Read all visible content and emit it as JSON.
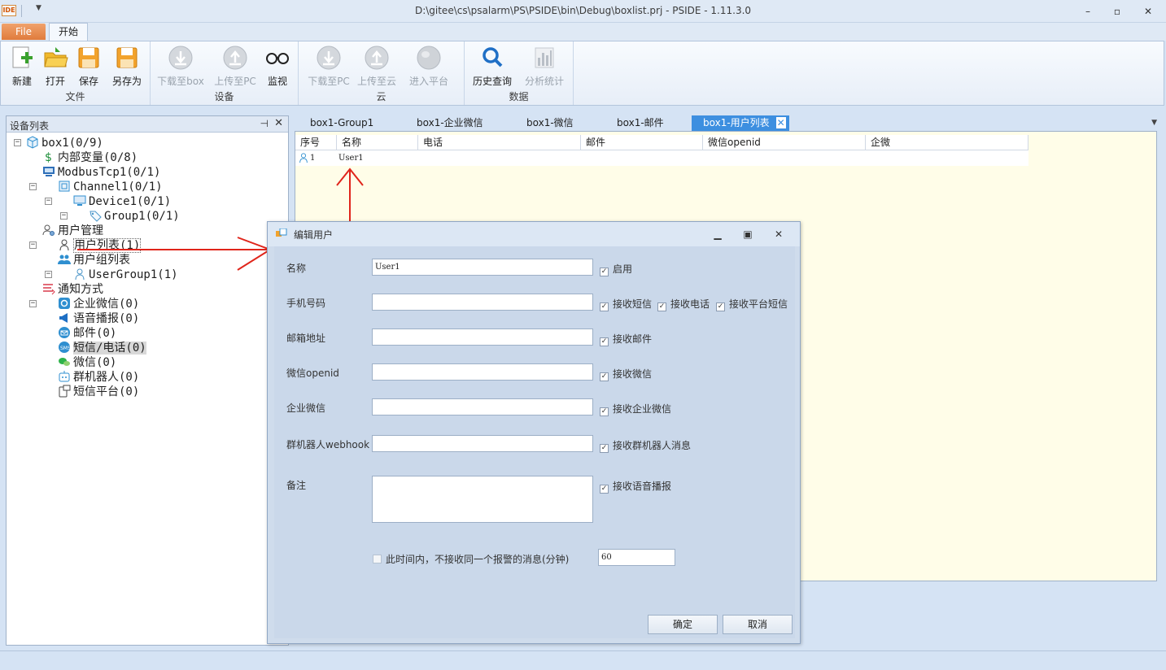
{
  "window": {
    "title": "D:\\gitee\\cs\\psalarm\\PS\\PSIDE\\bin\\Debug\\boxlist.prj - PSIDE - 1.11.3.0",
    "app_icon_text": "IDE",
    "minimize": "–",
    "restore": "▫",
    "close": "✕",
    "quick_access_drop": "▼"
  },
  "ribbon": {
    "file_tab": "File",
    "start_tab": "开始",
    "groups": {
      "file": {
        "label": "文件",
        "new": "新建",
        "open": "打开",
        "save": "保存",
        "save_as": "另存为"
      },
      "device": {
        "label": "设备",
        "download_box": "下载至box",
        "upload_pc": "上传至PC",
        "monitor": "监视"
      },
      "cloud": {
        "label": "云",
        "download_pc": "下载至PC",
        "upload_cloud": "上传至云",
        "enter_platform": "进入平台"
      },
      "data": {
        "label": "数据",
        "history": "历史查询",
        "analysis": "分析统计"
      }
    }
  },
  "left_panel": {
    "title": "设备列表",
    "pin": "📌",
    "close": "✕",
    "tree": [
      "box1(0/9)",
      "内部变量(0/8)",
      "ModbusTcp1(0/1)",
      "Channel1(0/1)",
      "Device1(0/1)",
      "Group1(0/1)",
      "用户管理",
      "用户列表(1)",
      "用户组列表",
      "UserGroup1(1)",
      "通知方式",
      "企业微信(0)",
      "语音播报(0)",
      "邮件(0)",
      "短信/电话(0)",
      "微信(0)",
      "群机器人(0)",
      "短信平台(0)"
    ]
  },
  "doc_tabs": [
    "box1-Group1",
    "box1-企业微信",
    "box1-微信",
    "box1-邮件",
    "box1-用户列表"
  ],
  "doc_tab_close": "✕",
  "tab_menu": "▼",
  "grid": {
    "headers": [
      "序号",
      "名称",
      "电话",
      "邮件",
      "微信openid",
      "企微"
    ],
    "row": {
      "index": "1",
      "name": "User1"
    }
  },
  "dialog": {
    "title": "编辑用户",
    "minimize": "▁",
    "restore": "▣",
    "close": "✕",
    "fields": {
      "name_label": "名称",
      "name_value": "User1",
      "phone_label": "手机号码",
      "email_label": "邮箱地址",
      "wechat_label": "微信openid",
      "wework_label": "企业微信",
      "robot_label": "群机器人webhook",
      "note_label": "备注"
    },
    "checkboxes": {
      "enabled": "启用",
      "recv_sms": "接收短信",
      "recv_call": "接收电话",
      "recv_platform_sms": "接收平台短信",
      "recv_email": "接收邮件",
      "recv_wechat": "接收微信",
      "recv_wework": "接收企业微信",
      "recv_robot": "接收群机器人消息",
      "recv_voice": "接收语音播报",
      "mute_repeat": "此时间内，不接收同一个报警的消息(分钟)"
    },
    "check_mark": "✓",
    "mute_minutes": "60",
    "ok": "确定",
    "cancel": "取消"
  },
  "colors": {
    "accent_tab": "#3d8fe0",
    "file_tab": "#e07b3c",
    "annotation_arrow": "#e0251b",
    "doc_background": "#fffde8"
  }
}
